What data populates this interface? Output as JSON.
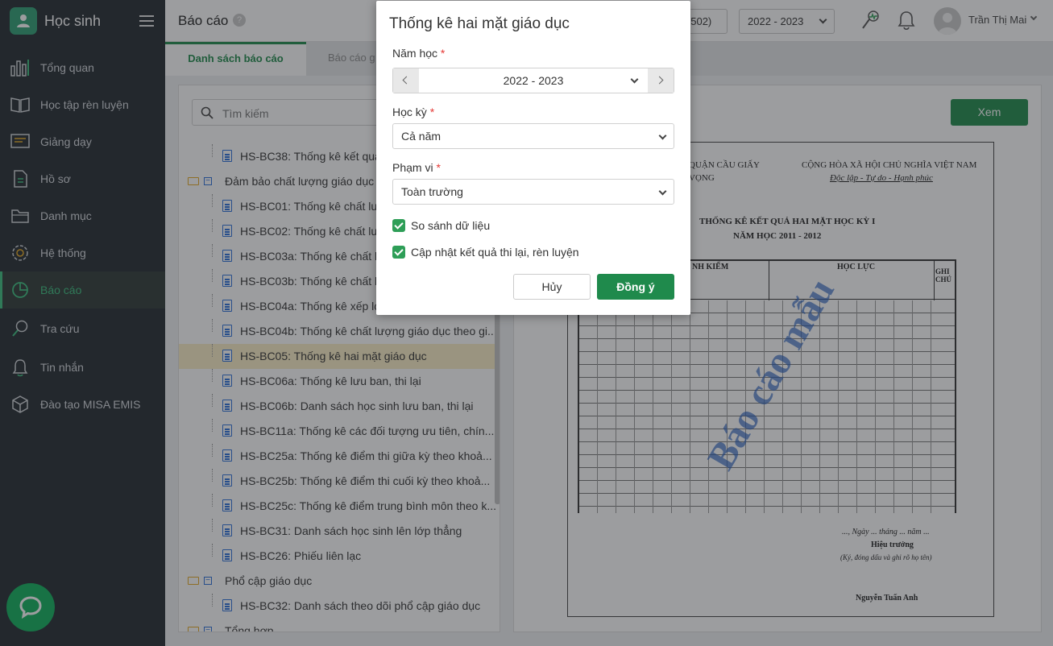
{
  "sidebar": {
    "app_name": "Học sinh",
    "items": [
      {
        "label": "Tổng quan"
      },
      {
        "label": "Học tập rèn luyện"
      },
      {
        "label": "Giảng dạy"
      },
      {
        "label": "Hồ sơ"
      },
      {
        "label": "Danh mục"
      },
      {
        "label": "Hệ thống"
      },
      {
        "label": "Báo cáo"
      },
      {
        "label": "Tra cứu"
      },
      {
        "label": "Tin nhắn"
      },
      {
        "label": "Đào tạo MISA EMIS"
      }
    ]
  },
  "header": {
    "title": "Báo cáo",
    "help": "?",
    "unit_code_partial": "0502)",
    "school_year": "2022 - 2023",
    "user_name": "Trần Thị Mai"
  },
  "tabs": {
    "active": "Danh sách báo cáo",
    "second_partial": "Báo cáo g"
  },
  "left": {
    "search_placeholder": "Tìm kiếm",
    "rows": [
      "HS-BC38: Thống kê kết quả c",
      "Đảm bảo chất lượng giáo dục",
      "HS-BC01: Thống kê chất lượ",
      "HS-BC02: Thống kê chất lượ",
      "HS-BC03a: Thống kê chất lư",
      "HS-BC03b: Thống kê chất lư",
      "HS-BC04a: Thống kê xếp loạ",
      "HS-BC04b: Thống kê chất lượng giáo dục theo gi...",
      "HS-BC05: Thống kê hai mặt giáo dục",
      "HS-BC06a: Thống kê lưu ban, thi lại",
      "HS-BC06b: Danh sách học sinh lưu ban, thi lại",
      "HS-BC11a: Thống kê các đối tượng ưu tiên, chín...",
      "HS-BC25a: Thống kê điểm thi giữa kỳ theo khoả...",
      "HS-BC25b: Thống kê điểm thi cuối kỳ theo khoả...",
      "HS-BC25c: Thống kê điểm trung bình môn theo k...",
      "HS-BC31: Danh sách học sinh lên lớp thẳng",
      "HS-BC26: Phiếu liên lạc",
      "Phổ cập giáo dục",
      "HS-BC32: Danh sách theo dõi phổ cập giáo dục",
      "Tổng hợp"
    ]
  },
  "right": {
    "view_button": "Xem",
    "preview": {
      "org_line1": "QUẬN CẦU GIẤY",
      "org_line2": "VỌNG",
      "nation": "CỘNG HÒA XÃ HỘI CHỦ NGHĨA VIỆT NAM",
      "motto": "Độc lập - Tự do - Hạnh phúc",
      "title": "THỐNG KÊ KẾT QUẢ HAI MẶT HỌC KỲ I",
      "year": "NĂM HỌC 2011 - 2012",
      "hanh_kiem": "NH KIỂM",
      "hoc_luc": "HỌC LỰC",
      "ghi_chu": "GHI CHÚ",
      "date_line": "..., Ngày ... tháng ... năm ...",
      "signer_title": "Hiệu trưởng",
      "signer_note": "(Ký, đóng dấu và ghi rõ họ tên)",
      "signer_name": "Nguyễn Tuấn Anh",
      "watermark": "Báo cáo mẫu"
    }
  },
  "modal": {
    "title": "Thống kê hai mặt giáo dục",
    "year_label": "Năm học",
    "year_value": "2022 - 2023",
    "semester_label": "Học kỳ",
    "semester_value": "Cả năm",
    "scope_label": "Phạm vi",
    "scope_value": "Toàn trường",
    "required_mark": "*",
    "compare_label": "So sánh dữ liệu",
    "update_label": "Cập nhật kết quả thi lại, rèn luyện",
    "cancel": "Hủy",
    "ok": "Đồng ý"
  }
}
